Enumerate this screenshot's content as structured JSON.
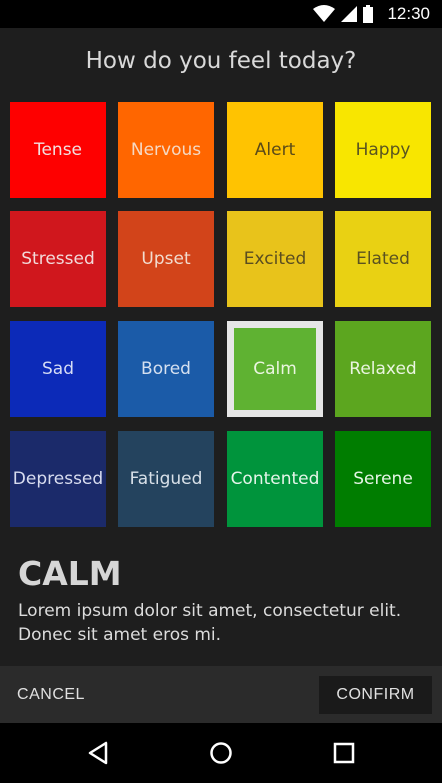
{
  "status_bar": {
    "time": "12:30",
    "icons": [
      "wifi-icon",
      "signal-icon",
      "battery-icon"
    ]
  },
  "dialog": {
    "title": "How do you feel today?",
    "moods": [
      {
        "label": "Tense",
        "color": "#fe0000",
        "text_color": "#f2e0e0"
      },
      {
        "label": "Nervous",
        "color": "#ff6600",
        "text_color": "#f5d9c4"
      },
      {
        "label": "Alert",
        "color": "#ffc301",
        "text_color": "#5a4a18"
      },
      {
        "label": "Happy",
        "color": "#f8e600",
        "text_color": "#5a5520"
      },
      {
        "label": "Stressed",
        "color": "#d0171d",
        "text_color": "#f2dada"
      },
      {
        "label": "Upset",
        "color": "#d2441a",
        "text_color": "#f2dccf"
      },
      {
        "label": "Excited",
        "color": "#e8c31b",
        "text_color": "#5a4d20"
      },
      {
        "label": "Elated",
        "color": "#e9d113",
        "text_color": "#5a5220"
      },
      {
        "label": "Sad",
        "color": "#0c2ab8",
        "text_color": "#d5dcf5"
      },
      {
        "label": "Bored",
        "color": "#1b5ba8",
        "text_color": "#d5e0f0"
      },
      {
        "label": "Calm",
        "color": "#5fb232",
        "text_color": "#eaf5e0",
        "selected": true
      },
      {
        "label": "Relaxed",
        "color": "#5ca61f",
        "text_color": "#eaf5e0"
      },
      {
        "label": "Depressed",
        "color": "#1b2a6a",
        "text_color": "#d8dcef"
      },
      {
        "label": "Fatigued",
        "color": "#24435e",
        "text_color": "#d8e0e8"
      },
      {
        "label": "Contented",
        "color": "#00943c",
        "text_color": "#e5f5ea"
      },
      {
        "label": "Serene",
        "color": "#007d00",
        "text_color": "#e5f5e5"
      }
    ],
    "selected_mood": {
      "title": "CALM",
      "description": "Lorem ipsum dolor sit amet, consectetur elit. Donec sit amet eros mi."
    },
    "actions": {
      "cancel_label": "CANCEL",
      "confirm_label": "CONFIRM"
    }
  },
  "nav_bar": {
    "icons": [
      "back-icon",
      "home-icon",
      "recents-icon"
    ]
  },
  "colors": {
    "background": "#1e1e1e",
    "selection_border": "#e6e6e6"
  }
}
